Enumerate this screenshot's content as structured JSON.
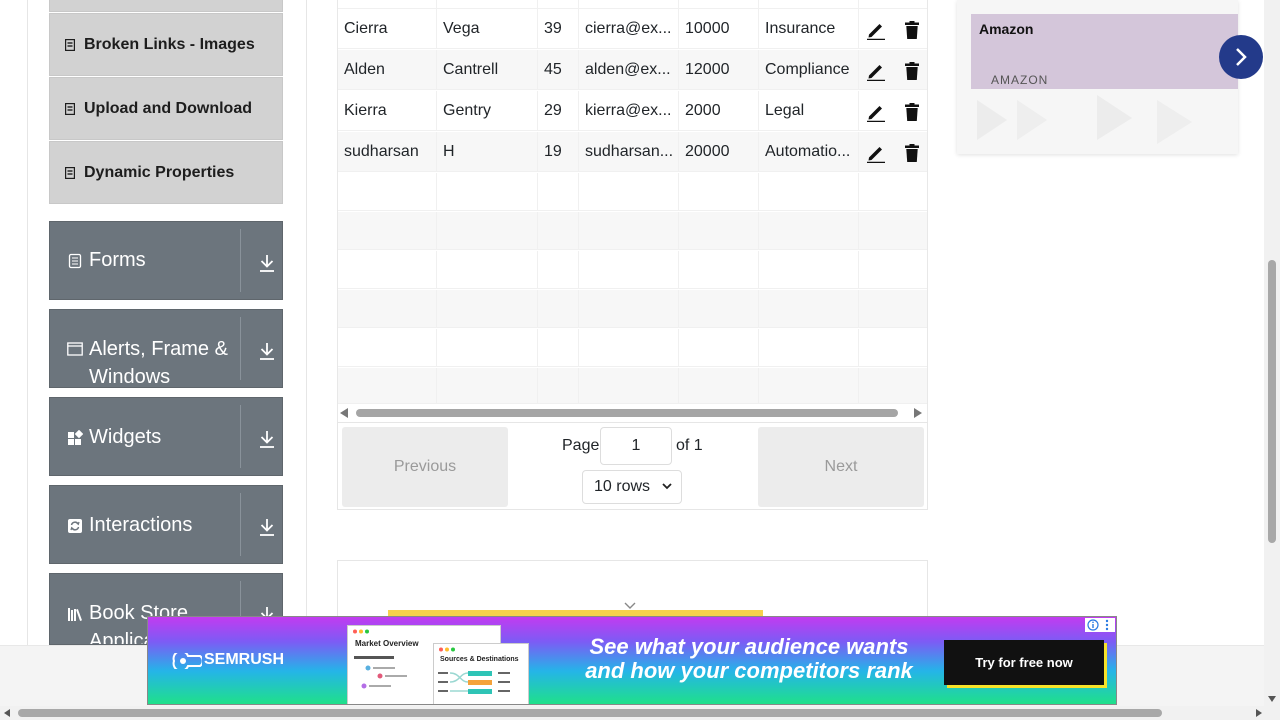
{
  "sidebar": {
    "submenu": [
      {
        "label": "Broken Links - Images"
      },
      {
        "label": "Upload and Download"
      },
      {
        "label": "Dynamic Properties"
      }
    ],
    "groups": [
      {
        "label": "Forms",
        "icon": "form-icon"
      },
      {
        "label": "Alerts, Frame &",
        "label2": "Windows",
        "icon": "window-icon"
      },
      {
        "label": "Widgets",
        "icon": "widgets-icon"
      },
      {
        "label": "Interactions",
        "icon": "interactions-icon"
      },
      {
        "label": "Book Store",
        "label2": "Applica",
        "icon": "bookstore-icon"
      }
    ]
  },
  "table": {
    "rows": [
      {
        "first": "Cierra",
        "last": "Vega",
        "age": "39",
        "email": "cierra@ex...",
        "salary": "10000",
        "dept": "Insurance"
      },
      {
        "first": "Alden",
        "last": "Cantrell",
        "age": "45",
        "email": "alden@ex...",
        "salary": "12000",
        "dept": "Compliance"
      },
      {
        "first": "Kierra",
        "last": "Gentry",
        "age": "29",
        "email": "kierra@ex...",
        "salary": "2000",
        "dept": "Legal"
      },
      {
        "first": "sudharsan",
        "last": "H",
        "age": "19",
        "email": "sudharsan...",
        "salary": "20000",
        "dept": "Automatio..."
      }
    ]
  },
  "pagination": {
    "previous_label": "Previous",
    "next_label": "Next",
    "page_label": "Page",
    "page_value": "1",
    "of_label": "of 1",
    "rows_selected": "10 rows"
  },
  "ad": {
    "title": "Amazon",
    "subtitle": "AMAZON"
  },
  "banner": {
    "brand": "SEMRUSH",
    "shot1_title": "Market Overview",
    "shot2_title": "Sources & Destinations",
    "headline_line1": "See what your audience wants",
    "headline_line2": "and how your competitors rank",
    "cta": "Try for free now"
  },
  "colors": {
    "sidebar_group": "#6c757d",
    "submenu": "#d2d2d2",
    "ad_accent": "#233a8a",
    "cta_shadow": "#f6e22a"
  }
}
